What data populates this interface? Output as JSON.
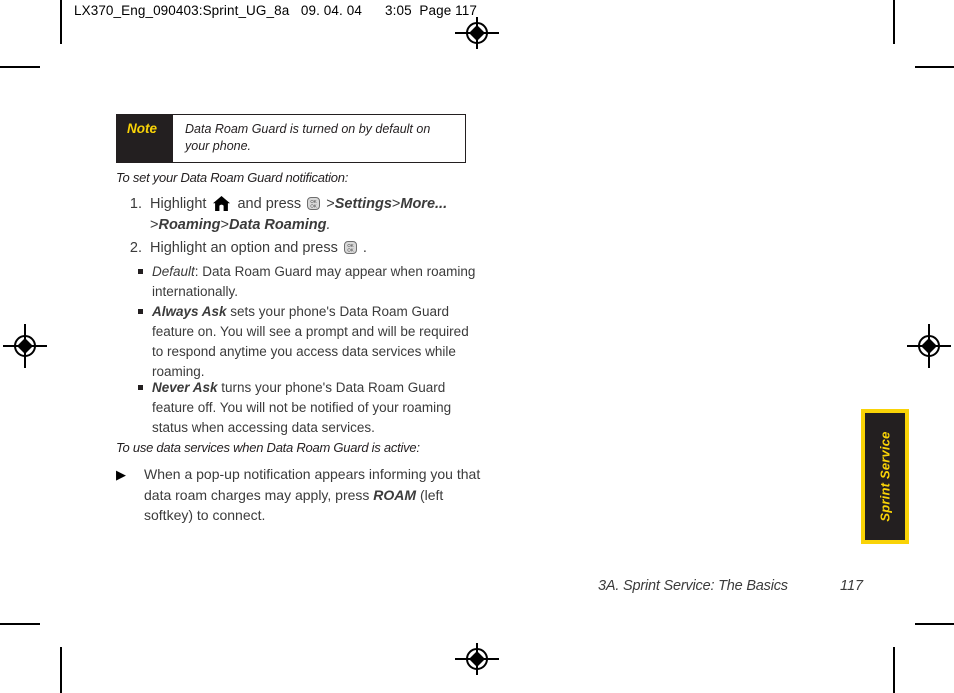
{
  "page": {
    "running_head": "LX370_Eng_090403:Sprint_UG_8a   09. 04. 04      3:05  Page 117",
    "footer_title": "3A. Sprint Service: The Basics",
    "footer_page": "117",
    "side_tab_label": "Sprint Service",
    "colors": {
      "accent_yellow": "#f9d307",
      "dark": "#231f20",
      "body_text": "#3b3b3b"
    }
  },
  "note": {
    "label": "Note",
    "text": "Data Roam Guard is turned on by default on your phone."
  },
  "sections": [
    {
      "heading": "To set your Data Roam Guard notification:",
      "steps": [
        {
          "number": "1.",
          "parts": [
            {
              "type": "text",
              "value": "Highlight "
            },
            {
              "type": "icon",
              "value": "home-icon"
            },
            {
              "type": "text",
              "value": " and press "
            },
            {
              "type": "icon",
              "value": "ok-key-icon"
            },
            {
              "type": "text",
              "value": " >"
            },
            {
              "type": "italic",
              "value": "Settings"
            },
            {
              "type": "text",
              "value": ">"
            },
            {
              "type": "italic",
              "value": "More..."
            },
            {
              "type": "text",
              "value": " >"
            },
            {
              "type": "italic",
              "value": "Roaming"
            },
            {
              "type": "text",
              "value": ">"
            },
            {
              "type": "italic",
              "value": "Data Roaming"
            },
            {
              "type": "italic",
              "value": "."
            }
          ]
        },
        {
          "number": "2.",
          "parts": [
            {
              "type": "text",
              "value": "Highlight an option and press "
            },
            {
              "type": "icon",
              "value": "ok-key-icon"
            },
            {
              "type": "text",
              "value": " ."
            }
          ]
        }
      ],
      "bullets": [
        {
          "term": "Default",
          "term_sep": ":",
          "rest": " Data Roam Guard may appear when roaming internationally."
        },
        {
          "term": "Always Ask",
          "term_sep": "",
          "rest": " sets your phone's Data Roam Guard feature on. You will see a prompt and will be required to respond anytime you access data services while roaming."
        },
        {
          "term": "Never Ask",
          "term_sep": "",
          "rest": " turns your phone's Data Roam Guard feature off. You will not be notified of your roaming status when accessing data services."
        }
      ]
    },
    {
      "heading": "To use data services when Data Roam Guard is active:",
      "triangle_item": {
        "bullet": "▶",
        "before": "When a pop-up notification appears informing you that data roam charges may apply, press ",
        "emphasis": "ROAM",
        "after": " (left softkey) to connect."
      }
    }
  ]
}
